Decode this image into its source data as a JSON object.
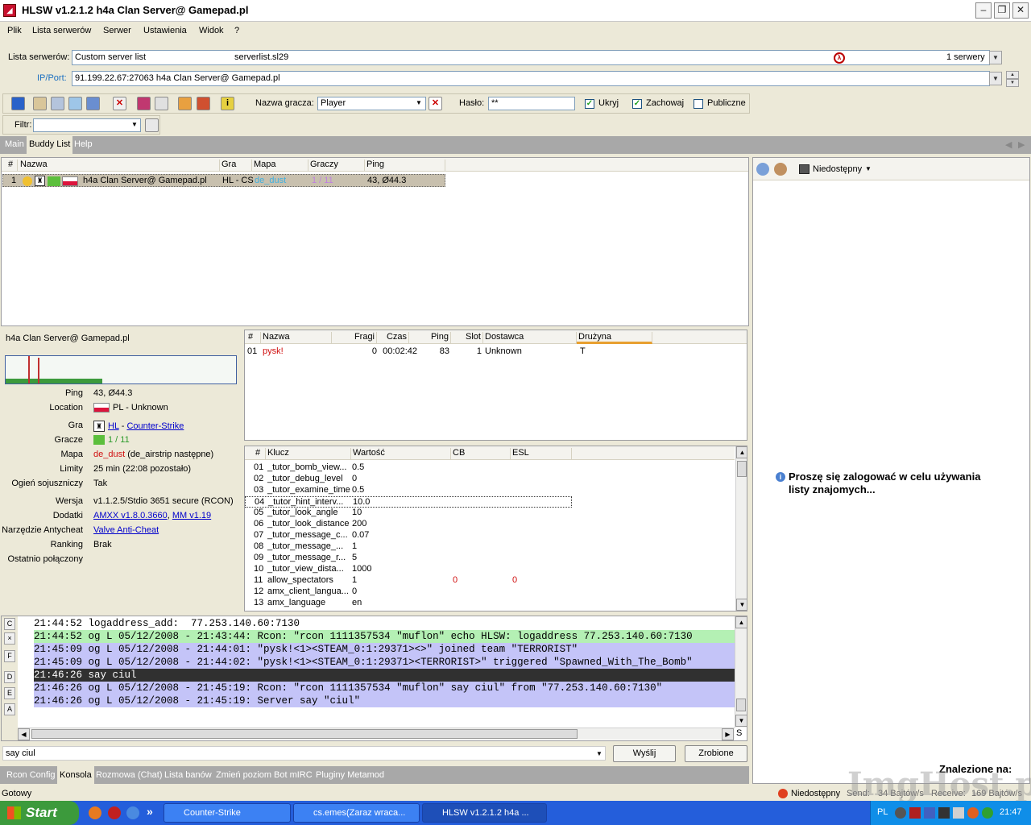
{
  "window": {
    "title": "HLSW v1.2.1.2   h4a Clan Server@ Gamepad.pl"
  },
  "menu": [
    "Plik",
    "Lista serwerów",
    "Serwer",
    "Ustawienia",
    "Widok",
    "?"
  ],
  "serverlist": {
    "label": "Lista serwerów:",
    "name": "Custom server list",
    "file": "serverlist.sl29",
    "count": "1 serwery"
  },
  "ipport": {
    "label": "IP/Port:",
    "value": "91.199.22.67:27063 h4a Clan Server@ Gamepad.pl"
  },
  "toolbar": {
    "player_label": "Nazwa gracza:",
    "player_value": "Player",
    "password_label": "Hasło:",
    "password_value": "**",
    "hide_label": "Ukryj",
    "keep_label": "Zachowaj",
    "public_label": "Publiczne",
    "filter_label": "Filtr:"
  },
  "tabs": [
    "Main",
    "Buddy List",
    "Help"
  ],
  "servers": {
    "columns": [
      "#",
      "Nazwa",
      "Gra",
      "Mapa",
      "Graczy",
      "Ping"
    ],
    "rows": [
      {
        "num": "1",
        "name": "h4a Clan Server@ Gamepad.pl",
        "game": "HL - CS",
        "map": "de_dust",
        "players": "1 / 11",
        "ping": "43, Ø44.3"
      }
    ]
  },
  "buddy": {
    "status": "Niedostępny",
    "message": "Proszę się zalogować w celu używania listy znajomych...",
    "found_label": "Znalezione na:"
  },
  "info": {
    "title": "h4a Clan Server@ Gamepad.pl",
    "rows": [
      {
        "label": "Ping",
        "value": "43, Ø44.3"
      },
      {
        "label": "Location",
        "value": "PL - Unknown"
      },
      {
        "label": "Gra",
        "value_links": [
          "HL",
          "Counter-Strike"
        ],
        "sep": " - "
      },
      {
        "label": "Gracze",
        "value": "1 / 11"
      },
      {
        "label": "Mapa",
        "value_red": "de_dust",
        "value": " (de_airstrip następne)"
      },
      {
        "label": "Limity",
        "value": "25 min (22:08 pozostało)"
      },
      {
        "label": "Ogień sojuszniczy",
        "value": "Tak"
      },
      {
        "label": "Wersja",
        "value": "v1.1.2.5/Stdio 3651 secure  (RCON)"
      },
      {
        "label": "Dodatki",
        "value_links": [
          "AMXX v1.8.0.3660",
          "MM v1.19"
        ],
        "sep": ", "
      },
      {
        "label": "Narzędzie Antycheat",
        "value_links": [
          "Valve Anti-Cheat"
        ],
        "sep": ""
      },
      {
        "label": "Ranking",
        "value": "Brak"
      },
      {
        "label": "Ostatnio połączony",
        "value": ""
      }
    ]
  },
  "players": {
    "columns": [
      "#",
      "Nazwa",
      "Fragi",
      "Czas",
      "Ping",
      "Slot",
      "Dostawca",
      "Drużyna"
    ],
    "rows": [
      {
        "num": "01",
        "name": "pysk!",
        "frags": "0",
        "time": "00:02:42",
        "ping": "83",
        "slot": "1",
        "provider": "Unknown",
        "team": "T"
      }
    ]
  },
  "rules": {
    "columns": [
      "#",
      "Klucz",
      "Wartość",
      "CB",
      "ESL"
    ],
    "rows": [
      {
        "num": "01",
        "key": "_tutor_bomb_view...",
        "value": "0.5",
        "cb": "",
        "esl": ""
      },
      {
        "num": "02",
        "key": "_tutor_debug_level",
        "value": "0",
        "cb": "",
        "esl": ""
      },
      {
        "num": "03",
        "key": "_tutor_examine_time",
        "value": "0.5",
        "cb": "",
        "esl": ""
      },
      {
        "num": "04",
        "key": "_tutor_hint_interv...",
        "value": "10.0",
        "cb": "",
        "esl": ""
      },
      {
        "num": "05",
        "key": "_tutor_look_angle",
        "value": "10",
        "cb": "",
        "esl": ""
      },
      {
        "num": "06",
        "key": "_tutor_look_distance",
        "value": "200",
        "cb": "",
        "esl": ""
      },
      {
        "num": "07",
        "key": "_tutor_message_c...",
        "value": "0.07",
        "cb": "",
        "esl": ""
      },
      {
        "num": "08",
        "key": "_tutor_message_...",
        "value": "1",
        "cb": "",
        "esl": ""
      },
      {
        "num": "09",
        "key": "_tutor_message_r...",
        "value": "5",
        "cb": "",
        "esl": ""
      },
      {
        "num": "10",
        "key": "_tutor_view_dista...",
        "value": "1000",
        "cb": "",
        "esl": ""
      },
      {
        "num": "11",
        "key": "allow_spectators",
        "value": "1",
        "cb": "0",
        "esl": "0"
      },
      {
        "num": "12",
        "key": "amx_client_langua...",
        "value": "0",
        "cb": "",
        "esl": ""
      },
      {
        "num": "13",
        "key": "amx_language",
        "value": "en",
        "cb": "",
        "esl": ""
      }
    ]
  },
  "console": {
    "side_buttons": [
      "C",
      "×",
      "F",
      "D",
      "E",
      "A"
    ],
    "lines": [
      {
        "text": "21:44:52 logaddress_add:  77.253.140.60:7130",
        "bg": "#ffffff",
        "fg": "#000000"
      },
      {
        "text": "21:44:52 og L 05/12/2008 - 21:43:44: Rcon: \"rcon 1111357534 \"muflon\" echo HLSW: logaddress 77.253.140.60:7130",
        "bg": "#b4f0b4",
        "fg": "#000000"
      },
      {
        "text": "21:45:09 og L 05/12/2008 - 21:44:01: \"pysk!<1><STEAM_0:1:29371><>\" joined team \"TERRORIST\"",
        "bg": "#c4c4f8",
        "fg": "#000000"
      },
      {
        "text": "21:45:09 og L 05/12/2008 - 21:44:02: \"pysk!<1><STEAM_0:1:29371><TERRORIST>\" triggered \"Spawned_With_The_Bomb\"",
        "bg": "#c4c4f8",
        "fg": "#000000"
      },
      {
        "text": "21:46:26 say ciul",
        "bg": "#303030",
        "fg": "#ffffff"
      },
      {
        "text": "21:46:26 og L 05/12/2008 - 21:45:19: Rcon: \"rcon 1111357534 \"muflon\" say ciul\" from \"77.253.140.60:7130\"",
        "bg": "#c4c4f8",
        "fg": "#000000"
      },
      {
        "text": "21:46:26 og L 05/12/2008 - 21:45:19: Server say \"ciul\"",
        "bg": "#c4c4f8",
        "fg": "#000000"
      }
    ],
    "input_value": "say ciul",
    "send_label": "Wyślij",
    "done_label": "Zrobione",
    "scroll_s": "S"
  },
  "bottom_tabs": [
    "Rcon Config",
    "Konsola",
    "Rozmowa (Chat)",
    "Lista banów",
    "Zmień poziom",
    "Bot mIRC",
    "Pluginy Metamod"
  ],
  "status": {
    "left": "Gotowy",
    "buddy": "Niedostępny",
    "send_label": "Send:",
    "send_value": "34 Bajtów/s",
    "receive_label": "Receive:",
    "receive_value": "169 Bajtów/s"
  },
  "taskbar": {
    "start": "Start",
    "tasks": [
      "Counter-Strike",
      "cs.emes(Zaraz wraca...",
      "HLSW v1.2.1.2  h4a ..."
    ],
    "lang": "PL",
    "clock": "21:47",
    "more": "»"
  },
  "watermark": "ImgHost.pl"
}
